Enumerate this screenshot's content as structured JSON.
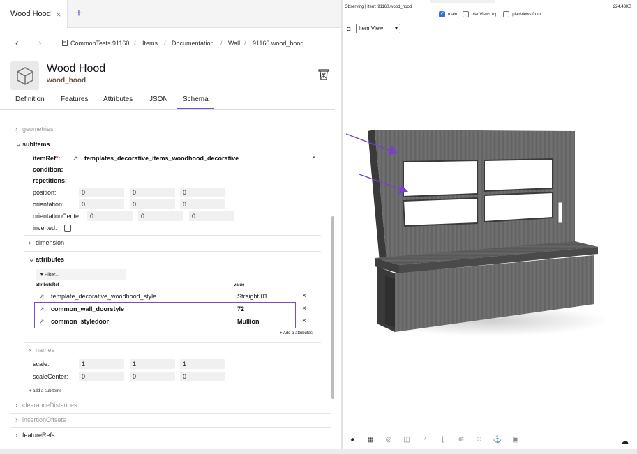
{
  "tab": {
    "title": "Wood Hood",
    "close": "×",
    "add": "+"
  },
  "breadcrumb": {
    "back": "‹",
    "forward": "›",
    "items": [
      "CommonTests 91160",
      "Items",
      "Documentation",
      "Wall",
      "91160.wood_hood"
    ],
    "sep": "/"
  },
  "header": {
    "title": "Wood Hood",
    "subtitle": "wood_hood"
  },
  "tabs": [
    "Definition",
    "Features",
    "Attributes",
    "JSON",
    "Schema"
  ],
  "schema": {
    "geometries": "geometries",
    "subItems": "subItems",
    "itemRef_label": "itemRef",
    "itemRef_star": "*:",
    "itemRef_value": "templates_decorative_items_woodhood_decorative",
    "condition": "condition:",
    "repetitions": "repetitions:",
    "position_label": "position:",
    "position": [
      "0",
      "0",
      "0"
    ],
    "orientation_label": "orientation:",
    "orientation": [
      "0",
      "0",
      "0"
    ],
    "orientationCenter_label": "orientationCente",
    "orientationCenter": [
      "0",
      "0",
      "0"
    ],
    "inverted_label": "inverted:",
    "dimension": "dimension",
    "attributes": "attributes",
    "filter_placeholder": "Filter...",
    "col_attributeRef": "attributeRef",
    "col_value": "value",
    "attr_rows": [
      {
        "ref": "template_decorative_woodhood_style",
        "value": "Straight 01"
      },
      {
        "ref": "common_wall_doorstyle",
        "value": "72"
      },
      {
        "ref": "common_styledoor",
        "value": "Mullion"
      }
    ],
    "add_attributes": "+ Add a attributes",
    "names": "names",
    "scale_label": "scale:",
    "scale": [
      "1",
      "1",
      "1"
    ],
    "scaleCenter_label": "scaleCenter:",
    "scaleCenter": [
      "0",
      "0",
      "0"
    ],
    "add_subitems": "+ add a subItems",
    "clearanceDistances": "clearanceDistances",
    "insertionOffsets": "insertionOffsets",
    "featureRefs": "featureRefs"
  },
  "viewer": {
    "observing": "Observing | Item: 91160.wood_hood",
    "size": "224.43KB",
    "views": [
      {
        "label": "main",
        "checked": true
      },
      {
        "label": "planViews.top",
        "checked": false
      },
      {
        "label": "planViews.front",
        "checked": false
      }
    ],
    "select_value": "Item View"
  },
  "colors": {
    "accent": "#6a55d8",
    "highlight": "#7b4ac9",
    "arrow": "#7a3fd0"
  }
}
